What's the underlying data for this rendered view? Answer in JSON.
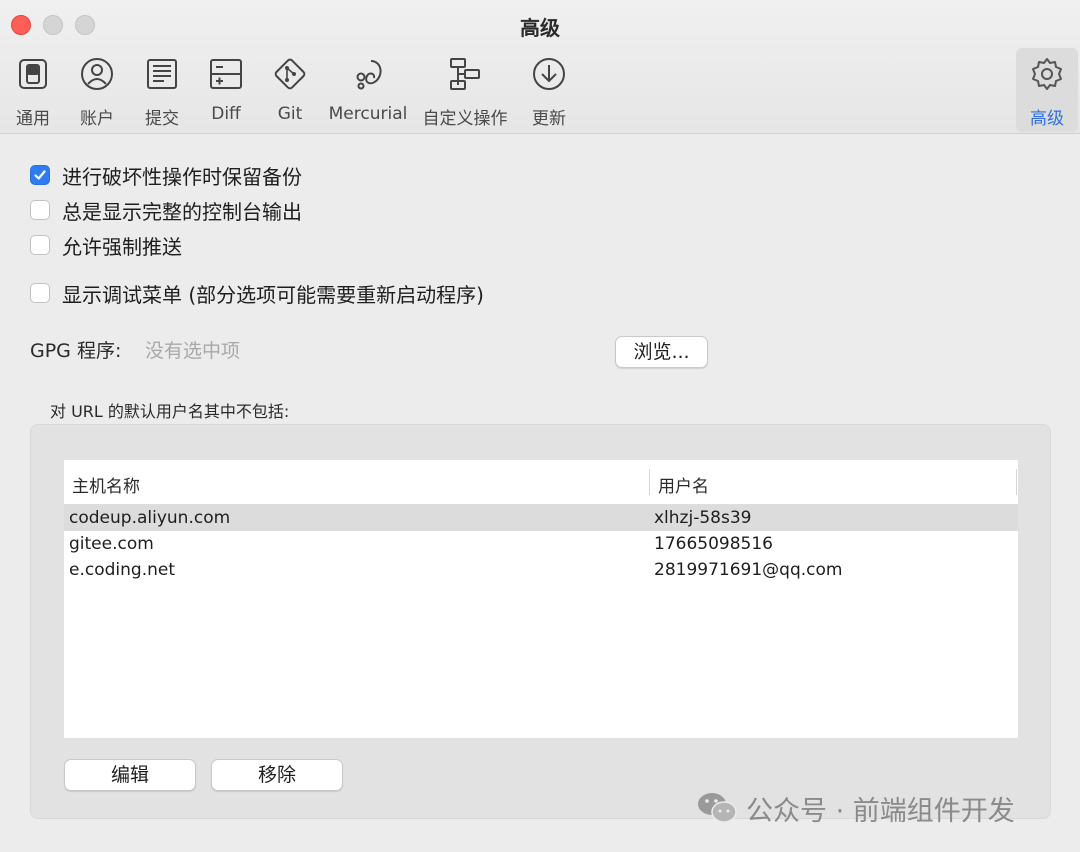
{
  "window": {
    "title": "高级",
    "buttons": [
      "close",
      "minimize",
      "maximize"
    ]
  },
  "toolbar": {
    "items": [
      {
        "label": "通用",
        "icon": "switch-icon",
        "active": false
      },
      {
        "label": "账户",
        "icon": "user-icon",
        "active": false
      },
      {
        "label": "提交",
        "icon": "document-lines-icon",
        "active": false
      },
      {
        "label": "Diff",
        "icon": "diff-icon",
        "active": false
      },
      {
        "label": "Git",
        "icon": "git-icon",
        "active": false
      },
      {
        "label": "Mercurial",
        "icon": "mercurial-icon",
        "active": false
      },
      {
        "label": "自定义操作",
        "icon": "custom-actions-icon",
        "active": false
      },
      {
        "label": "更新",
        "icon": "download-icon",
        "active": false
      },
      {
        "label": "高级",
        "icon": "gear-icon",
        "active": true
      }
    ],
    "active_color": "#2f6fe0"
  },
  "options": {
    "keep_backup": {
      "label": "进行破坏性操作时保留备份",
      "checked": true
    },
    "show_full_console": {
      "label": "总是显示完整的控制台输出",
      "checked": false
    },
    "allow_force_push": {
      "label": "允许强制推送",
      "checked": false
    },
    "show_debug_menu": {
      "label": "显示调试菜单 (部分选项可能需要重新启动程序)",
      "checked": false
    }
  },
  "gpg": {
    "label": "GPG 程序:",
    "value": "没有选中项",
    "browse_label": "浏览..."
  },
  "url_usernames": {
    "label": "对 URL 的默认用户名其中不包括:",
    "columns": [
      "主机名称",
      "用户名"
    ],
    "rows": [
      {
        "host": "codeup.aliyun.com",
        "user": "xlhzj-58s39",
        "selected": true
      },
      {
        "host": "gitee.com",
        "user": "17665098516",
        "selected": false
      },
      {
        "host": "e.coding.net",
        "user": "2819971691@qq.com",
        "selected": false
      }
    ],
    "edit_label": "编辑",
    "remove_label": "移除"
  },
  "watermark": {
    "text": "公众号 · 前端组件开发",
    "icon": "wechat-icon"
  },
  "colors": {
    "checkbox_checked": "#2f7bf2",
    "close_button": "#ff5f57",
    "selected_row": "#dcdcdc"
  }
}
